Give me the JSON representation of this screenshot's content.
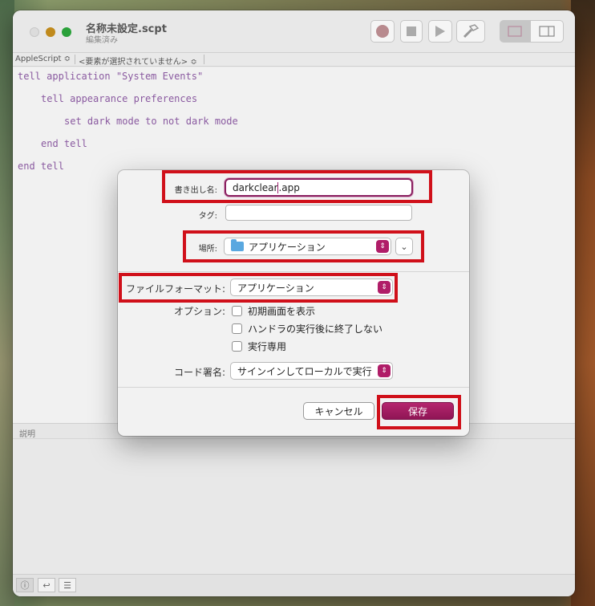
{
  "window": {
    "title": "名称未設定.scpt",
    "subtitle": "編集済み"
  },
  "navbar": {
    "language": "AppleScript ≎",
    "selection": "<要素が選択されていません> ≎"
  },
  "code": [
    "tell application \"System Events\"",
    "tell appearance preferences",
    "set dark mode to not dark mode",
    "end tell",
    "end tell"
  ],
  "dialog": {
    "export_label": "書き出し名:",
    "export_value_before": "darkclear",
    "export_value_after": ".app",
    "tags_label": "タグ:",
    "tags_value": "",
    "location_label": "場所:",
    "location_value": "アプリケーション",
    "format_label": "ファイルフォーマット:",
    "format_value": "アプリケーション",
    "options_label": "オプション:",
    "options": [
      "初期画面を表示",
      "ハンドラの実行後に終了しない",
      "実行専用"
    ],
    "codesign_label": "コード署名:",
    "codesign_value": "サインインしてローカルで実行",
    "cancel_label": "キャンセル",
    "save_label": "保存"
  },
  "description": {
    "label": "説明"
  },
  "colors": {
    "accent": "#b01d68",
    "highlight": "#d0101a",
    "code": "#8a5aa0"
  }
}
